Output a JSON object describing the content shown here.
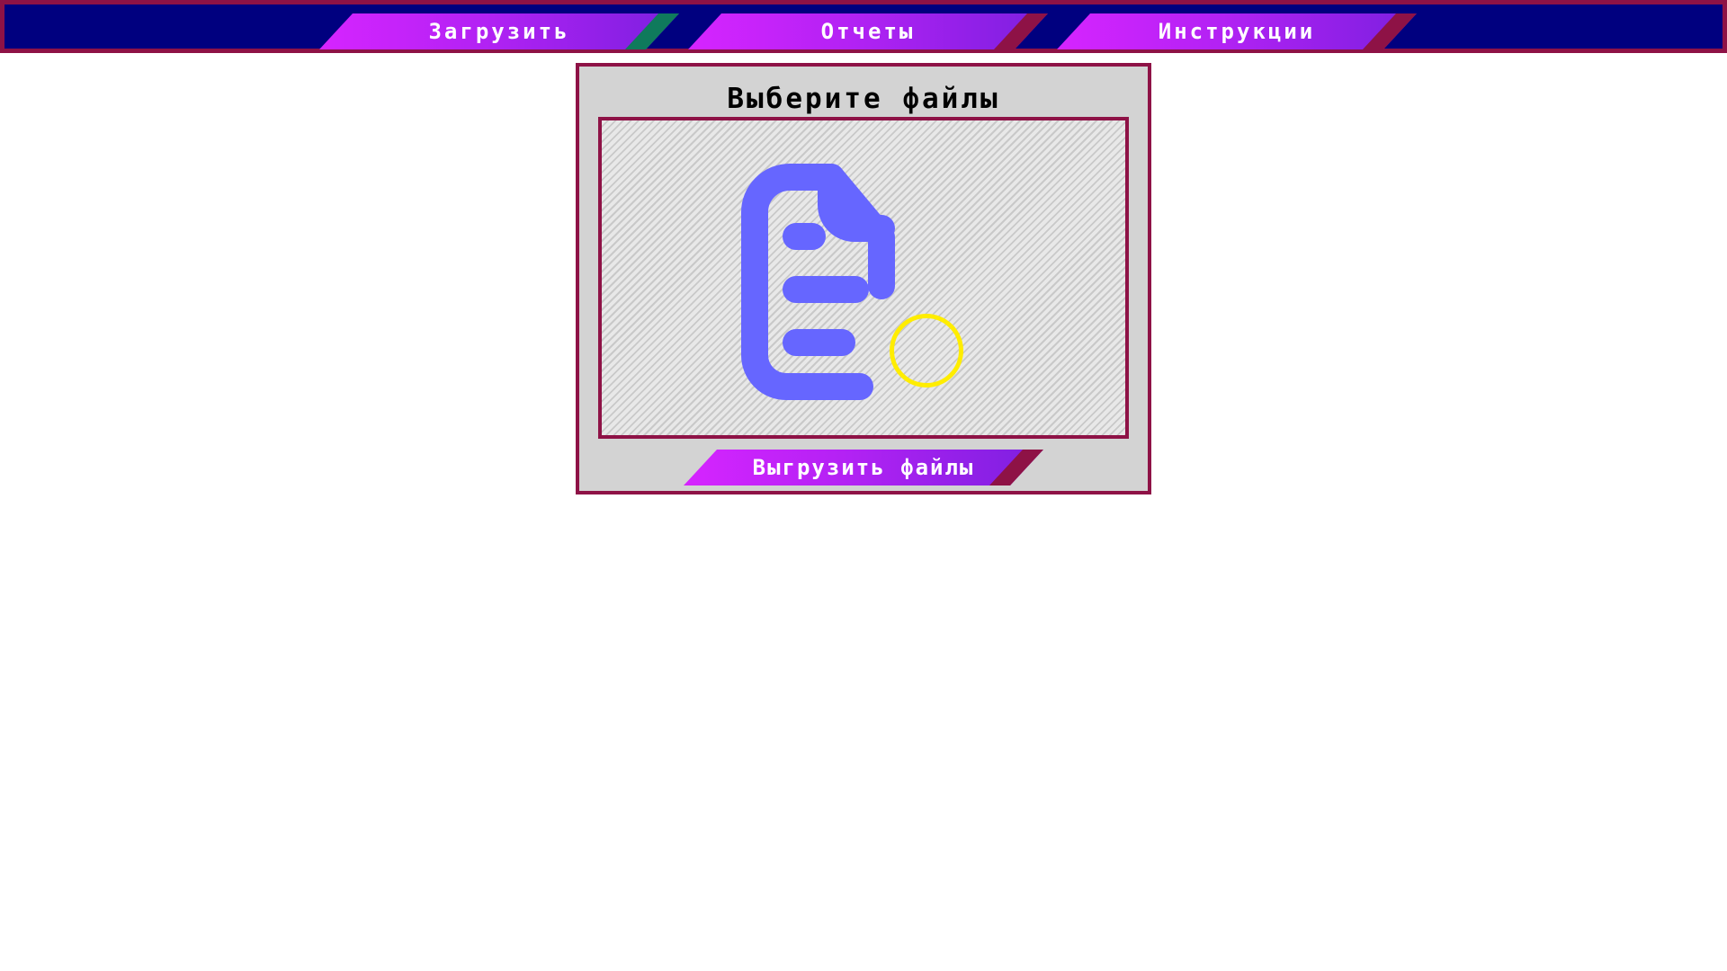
{
  "nav": {
    "items": [
      {
        "label": "Загрузить",
        "accent_color": "#0f7a5c",
        "active": true
      },
      {
        "label": "Отчеты",
        "accent_color": "#8e1246",
        "active": false
      },
      {
        "label": "Инструкции",
        "accent_color": "#8e1246",
        "active": false
      }
    ]
  },
  "upload": {
    "title": "Выберите файлы",
    "dropzone_icon": "file-document-icon",
    "submit_label": "Выгрузить файлы"
  },
  "theme": {
    "topbar_bg": "#00007f",
    "border": "#8e1246",
    "button_gradient_start": "#d624ff",
    "button_gradient_end": "#7c1fe0",
    "panel_bg": "#d3d3d3",
    "icon_color": "#6666ff",
    "cursor_ring": "#ffed00"
  }
}
